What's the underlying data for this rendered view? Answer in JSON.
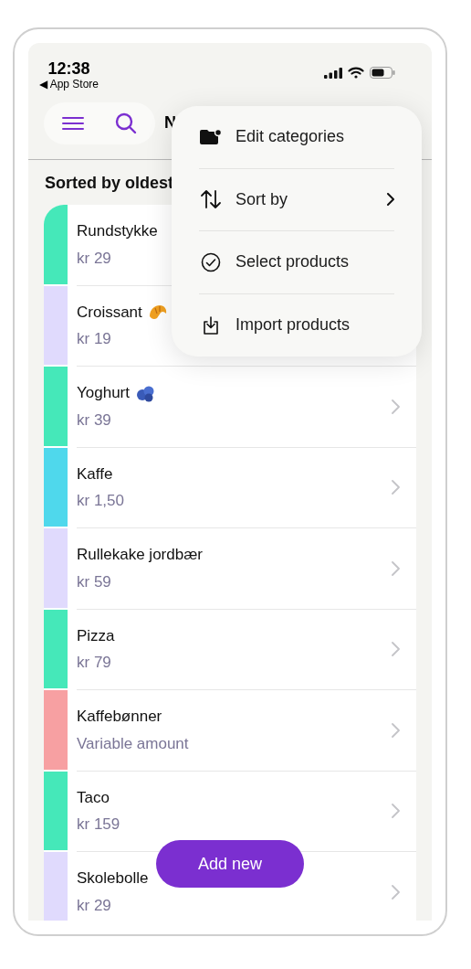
{
  "status_bar": {
    "time": "12:38",
    "back_label": "◀ App Store"
  },
  "header": {
    "title": "N"
  },
  "sort_label": "Sorted by oldest",
  "products": [
    {
      "name": "Rundstykke",
      "price": "kr 29",
      "color": "#45e8b9",
      "kind": "plain"
    },
    {
      "name": "Croissant",
      "price": "kr 19",
      "color": "#e0dafd",
      "kind": "croissant"
    },
    {
      "name": "Yoghurt",
      "price": "kr 39",
      "color": "#45e8b9",
      "kind": "blueberries"
    },
    {
      "name": "Kaffe",
      "price": "kr 1,50",
      "color": "#4fd8ec",
      "kind": "plain"
    },
    {
      "name": "Rullekake jordbær",
      "price": "kr 59",
      "color": "#e0dafd",
      "kind": "plain"
    },
    {
      "name": "Pizza",
      "price": "kr 79",
      "color": "#45e8b9",
      "kind": "plain"
    },
    {
      "name": "Kaffebønner",
      "price": "Variable amount",
      "color": "#f7a0a2",
      "kind": "plain"
    },
    {
      "name": "Taco",
      "price": "kr 159",
      "color": "#45e8b9",
      "kind": "plain"
    },
    {
      "name": "Skolebolle",
      "price": "kr 29",
      "color": "#e0dafd",
      "kind": "plain"
    }
  ],
  "menu": [
    {
      "label": "Edit categories",
      "kind": "folder",
      "submenu": false
    },
    {
      "label": "Sort by",
      "kind": "sort",
      "submenu": true
    },
    {
      "label": "Select products",
      "kind": "select",
      "submenu": false
    },
    {
      "label": "Import products",
      "kind": "import",
      "submenu": false
    }
  ],
  "add_button": "Add new"
}
